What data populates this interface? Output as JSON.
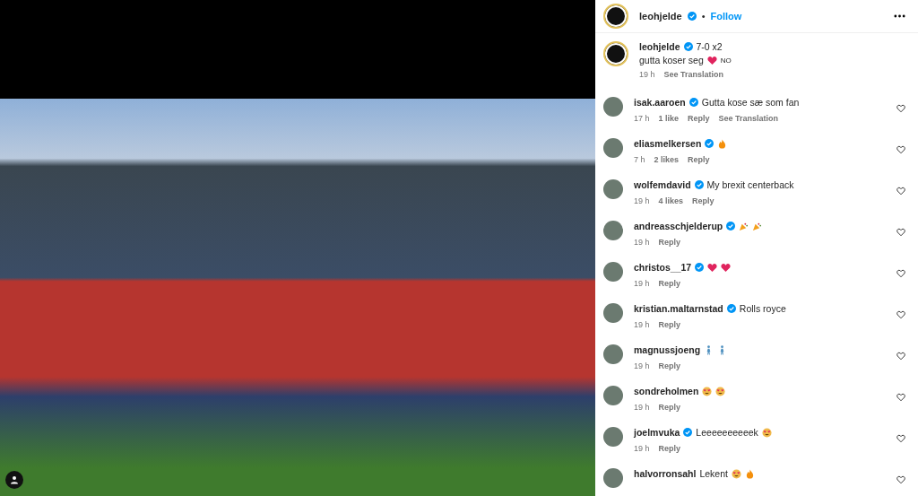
{
  "post": {
    "photo": {
      "tagged": true
    }
  },
  "header": {
    "username": "leohjelde",
    "verified": true,
    "separator": "•",
    "follow": "Follow"
  },
  "caption": {
    "username": "leohjelde",
    "verified": true,
    "text": "7-0 x2",
    "line2": "gutta koser seg",
    "reactions": [
      {
        "kind": "heart"
      }
    ],
    "tag": "NO",
    "time": "19 h",
    "translation": "See Translation"
  },
  "comments": [
    {
      "username": "isak.aaroen",
      "verified": true,
      "text": "Gutta kose sæ som fan",
      "time": "17 h",
      "likes": "1 like",
      "reply": "Reply",
      "translation": "See Translation",
      "liked": false
    },
    {
      "username": "eliasmelkersen",
      "verified": true,
      "reactions": [
        {
          "kind": "fire"
        }
      ],
      "time": "7 h",
      "likes": "2 likes",
      "reply": "Reply",
      "liked": false
    },
    {
      "username": "wolfemdavid",
      "verified": true,
      "text": "My brexit centerback",
      "time": "19 h",
      "likes": "4 likes",
      "reply": "Reply",
      "liked": false
    },
    {
      "username": "andreasschjelderup",
      "verified": true,
      "reactions": [
        {
          "kind": "party"
        },
        {
          "kind": "party"
        }
      ],
      "time": "19 h",
      "reply": "Reply",
      "liked": false
    },
    {
      "username": "christos__17",
      "verified": true,
      "reactions": [
        {
          "kind": "heart"
        },
        {
          "kind": "heart"
        }
      ],
      "time": "19 h",
      "reply": "Reply",
      "liked": false
    },
    {
      "username": "kristian.maltarnstad",
      "verified": true,
      "text": "Rolls royce",
      "time": "19 h",
      "reply": "Reply",
      "liked": false
    },
    {
      "username": "magnussjoeng",
      "verified": false,
      "reactions": [
        {
          "kind": "walker"
        },
        {
          "kind": "walker"
        }
      ],
      "time": "19 h",
      "reply": "Reply",
      "liked": false
    },
    {
      "username": "sondreholmen",
      "verified": false,
      "reactions": [
        {
          "kind": "hearteyes"
        },
        {
          "kind": "hearteyes"
        }
      ],
      "time": "19 h",
      "reply": "Reply",
      "liked": false
    },
    {
      "username": "joelmvuka",
      "verified": true,
      "text": "Leeeeeeeeeek",
      "reactions": [
        {
          "kind": "hearteyes"
        }
      ],
      "time": "19 h",
      "reply": "Reply",
      "liked": false
    },
    {
      "username": "halvorronsahl",
      "verified": false,
      "text": "Lekent",
      "reactions": [
        {
          "kind": "hearteyes"
        },
        {
          "kind": "fire"
        }
      ],
      "liked": false
    }
  ]
}
